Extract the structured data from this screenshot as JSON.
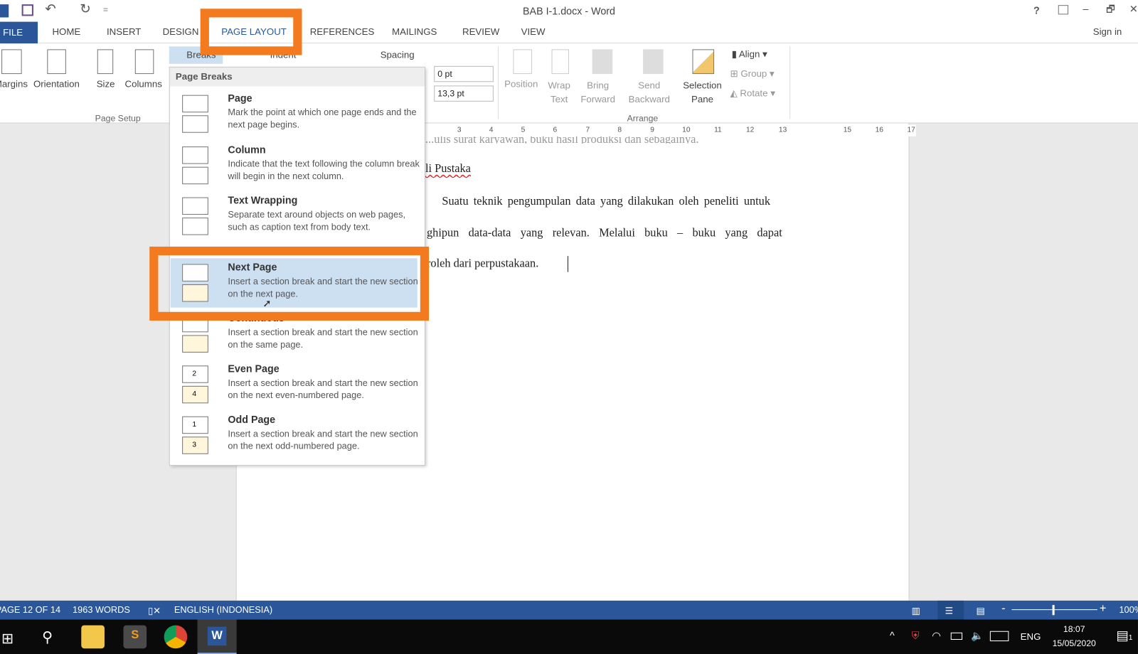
{
  "window": {
    "title": "BAB I-1.docx - Word",
    "sign_in": "Sign in",
    "help": "?",
    "minimize": "–",
    "restore": "🗗",
    "close": "✕"
  },
  "quick_access": {
    "undo": "↶",
    "redo": "↻",
    "customize": "="
  },
  "tabs": {
    "file": "FILE",
    "items": [
      "HOME",
      "INSERT",
      "DESIGN",
      "PAGE LAYOUT",
      "REFERENCES",
      "MAILINGS",
      "REVIEW",
      "VIEW"
    ],
    "active": "PAGE LAYOUT"
  },
  "ribbon": {
    "page_setup": {
      "label": "Page Setup",
      "margins": "Margins",
      "orientation": "Orientation",
      "size": "Size",
      "columns": "Columns",
      "breaks": "Breaks"
    },
    "paragraph": {
      "indent": "Indent",
      "spacing": "Spacing",
      "before": "0 pt",
      "after": "13,3 pt"
    },
    "arrange": {
      "label": "Arrange",
      "position": "Position",
      "wrap_text": [
        "Wrap",
        "Text"
      ],
      "bring_forward": [
        "Bring",
        "Forward"
      ],
      "send_backward": [
        "Send",
        "Backward"
      ],
      "selection_pane": [
        "Selection",
        "Pane"
      ],
      "align": "Align",
      "group": "Group",
      "rotate": "Rotate"
    }
  },
  "breaks_menu": {
    "page_breaks_header": "Page Breaks",
    "items": [
      {
        "title": "Page",
        "desc": "Mark the point at which one page ends and the next page begins."
      },
      {
        "title": "Column",
        "desc": "Indicate that the text following the column break will begin in the next column."
      },
      {
        "title": "Text Wrapping",
        "desc": "Separate text around objects on web pages, such as caption text from body text."
      },
      {
        "title": "Next Page",
        "desc": "Insert a section break and start the new section on the next page."
      },
      {
        "title": "Continuous",
        "desc": "Insert a section break and start the new section on the same page."
      },
      {
        "title": "Even Page",
        "desc": "Insert a section break and start the new section on the next even-numbered page."
      },
      {
        "title": "Odd Page",
        "desc": "Insert a section break and start the new section on the next odd-numbered page."
      }
    ],
    "selected": "Next Page"
  },
  "ruler": [
    "3",
    "4",
    "5",
    "6",
    "7",
    "8",
    "9",
    "10",
    "11",
    "12",
    "13",
    "15",
    "16",
    "17"
  ],
  "document": {
    "line0": "...ulis surat karyawan, buku hasil produksi dan sebagainya.",
    "heading": "li Pustaka",
    "p1": "Suatu teknik pengumpulan data yang dilakukan oleh peneliti untuk",
    "p2": "ghipun data-data yang relevan. Melalui buku – buku yang dapat",
    "p3": "roleh dari perpustakaan."
  },
  "status": {
    "page": "PAGE 12 OF 14",
    "words": "1963 WORDS",
    "language": "ENGLISH (INDONESIA)",
    "zoom": "100%"
  },
  "taskbar": {
    "lang": "ENG",
    "time": "18:07",
    "date": "15/05/2020",
    "notifications": "1"
  },
  "colors": {
    "word_blue": "#2b579a",
    "highlight": "#f47a20",
    "menu_selected": "#cde0f2"
  }
}
